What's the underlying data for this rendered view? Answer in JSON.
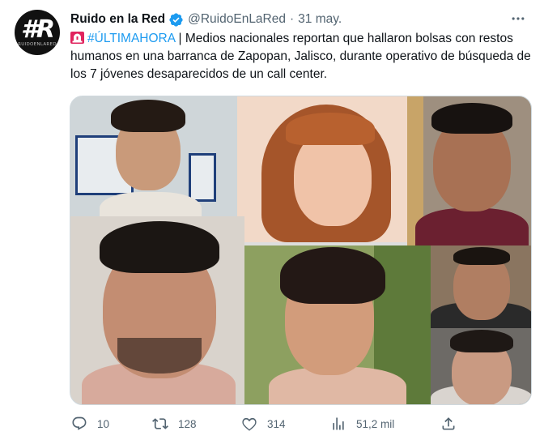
{
  "author": {
    "avatar_text": "#R",
    "avatar_sub": "RUIDOENLARED",
    "display_name": "Ruido en la Red",
    "handle": "@RuidoEnLaRed",
    "separator": "·",
    "date": "31 may."
  },
  "tweet": {
    "hashtag": "#ÚLTIMAHORA",
    "text": " | Medios nacionales reportan que hallaron bolsas con restos humanos en una barranca de Zapopan, Jalisco, durante operativo de búsqueda de los 7 jóvenes desaparecidos de un call center."
  },
  "actions": {
    "replies": "10",
    "retweets": "128",
    "likes": "314",
    "views": "51,2 mil"
  },
  "icons": [
    "verified-badge-icon",
    "more-icon",
    "siren-icon",
    "reply-icon",
    "retweet-icon",
    "like-icon",
    "views-icon",
    "share-icon"
  ],
  "colors": {
    "text": "#0f1419",
    "secondary": "#536471",
    "link": "#1d9bf0",
    "border": "#cfd9de"
  }
}
